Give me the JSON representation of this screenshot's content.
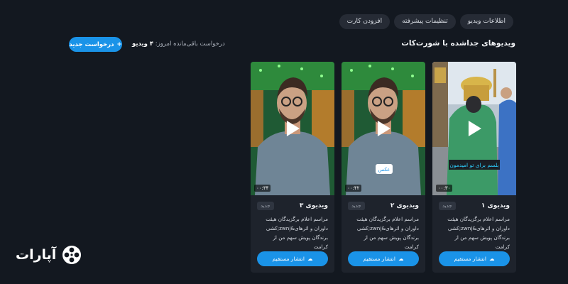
{
  "tabs": [
    {
      "label": "اطلاعات ویدیو"
    },
    {
      "label": "تنظیمات پیشرفته"
    },
    {
      "label": "افزودن کارت"
    }
  ],
  "section": {
    "title": "ویدیوهای جداشده با شورت‌کات",
    "remaining_label": "درخواست باقی‌مانده امروز:",
    "remaining_count": "۴ ویدیو",
    "new_request_label": "درخواست جدید",
    "new_request_icon": "plus-icon"
  },
  "cards": [
    {
      "title": "ویدیوی ۱",
      "badge": "جدید",
      "duration": "۰۰:۳۰",
      "overlay_text": "بلسم برای تو امیدمون",
      "description": "مراسم اعلام برگزیدگان هیئت داوران و اثرهای&zwnj;کشی برندگان پویش سهم من از کرامت",
      "publish_label": "انتشار مستقیم"
    },
    {
      "title": "ویدیوی ۲",
      "badge": "جدید",
      "duration": "۰۰:۴۲",
      "overlay_text": "عکس",
      "description": "مراسم اعلام برگزیدگان هیئت داوران و اثرهای&zwnj;کشی برندگان پویش سهم من از کرامت",
      "publish_label": "انتشار مستقیم"
    },
    {
      "title": "ویدیوی ۳",
      "badge": "جدید",
      "duration": "۰۰:۳۴",
      "description": "مراسم اعلام برگزیدگان هیئت داوران و اثرهای&zwnj;کشی برندگان پویش سهم من از کرامت",
      "publish_label": "انتشار مستقیم"
    }
  ],
  "brand": {
    "name": "آپارات",
    "icon": "aparat-reel-icon"
  },
  "colors": {
    "accent": "#1a93e8",
    "background": "#131820",
    "card": "#1e232c"
  }
}
